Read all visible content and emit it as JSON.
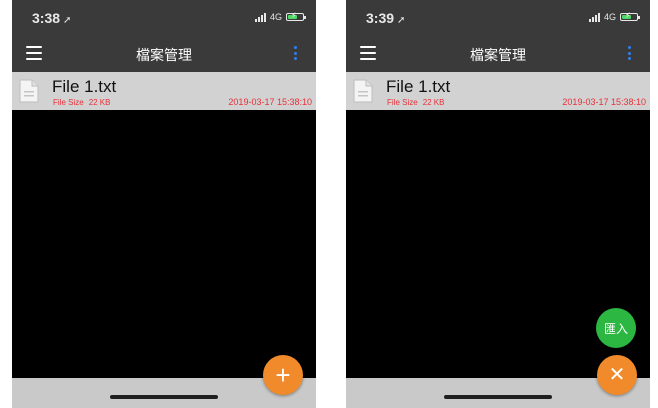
{
  "screens": [
    {
      "status": {
        "time": "3:38",
        "network": "4G"
      },
      "header": {
        "title": "檔案管理"
      },
      "files": [
        {
          "name": "File 1.txt",
          "size_label": "File Size",
          "size": "22 KB",
          "date": "2019-03-17 15:38:10"
        }
      ],
      "fab": {
        "state": "collapsed",
        "icon": "plus-icon"
      }
    },
    {
      "status": {
        "time": "3:39",
        "network": "4G"
      },
      "header": {
        "title": "檔案管理"
      },
      "files": [
        {
          "name": "File 1.txt",
          "size_label": "File Size",
          "size": "22 KB",
          "date": "2019-03-17 15:38:10"
        }
      ],
      "fab": {
        "state": "expanded",
        "icon": "close-icon",
        "import_label": "匯入"
      }
    }
  ],
  "colors": {
    "header_bg": "#3a3a3a",
    "file_row_bg": "#d2d2d2",
    "file_meta": "#e8303a",
    "more_menu_dots": "#2f7ff0",
    "fab_orange": "#f08a2a",
    "import_green": "#2bb741"
  }
}
